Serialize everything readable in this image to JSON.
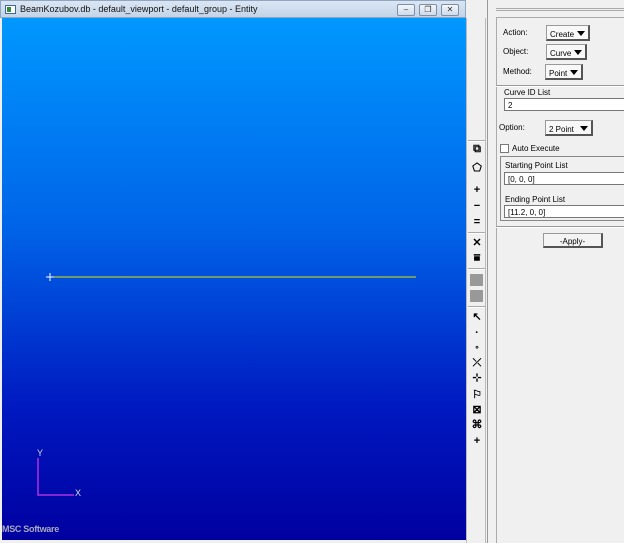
{
  "window": {
    "title": "BeamKozubov.db - default_viewport - default_group - Entity",
    "minimize": "–",
    "restore": "❐",
    "close": "✕"
  },
  "viewport": {
    "axis_x": "X",
    "axis_y": "Y",
    "logo": "MSC Software",
    "line_color": "#e8e000"
  },
  "toolbar": {
    "icons": [
      "copy",
      "polygon",
      "plus",
      "minus",
      "equals",
      "cross-cut",
      "filter",
      "square1",
      "square2",
      "arrow",
      "dot",
      "small-circle",
      "curve-x",
      "curve-tangent",
      "flag-select",
      "box-select",
      "node-select",
      "crosshair"
    ]
  },
  "panel": {
    "action_label": "Action:",
    "action_value": "Create",
    "object_label": "Object:",
    "object_value": "Curve",
    "method_label": "Method:",
    "method_value": "Point",
    "curve_id_label": "Curve ID List",
    "curve_id_value": "2",
    "option_label": "Option:",
    "option_value": "2 Point",
    "auto_execute_label": "Auto Execute",
    "auto_execute_checked": false,
    "start_label": "Starting Point List",
    "start_value": "[0, 0, 0]",
    "end_label": "Ending Point List",
    "end_value": "[11.2, 0, 0]",
    "apply_label": "-Apply-"
  }
}
